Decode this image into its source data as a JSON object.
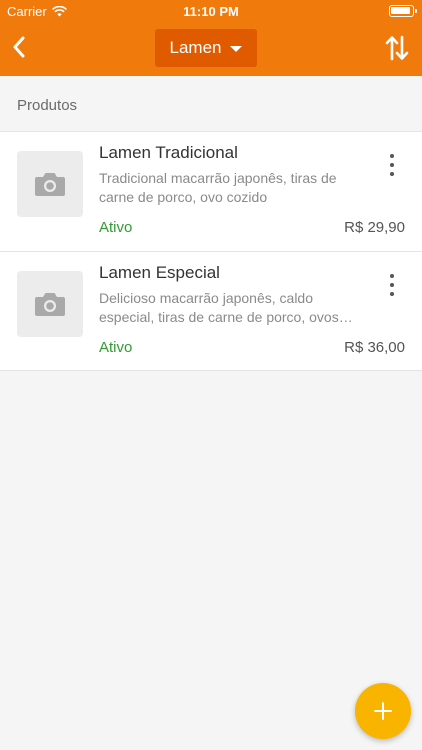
{
  "status_bar": {
    "carrier": "Carrier",
    "time": "11:10 PM"
  },
  "header": {
    "category_label": "Lamen",
    "back_icon": "chevron-left-icon",
    "sort_icon": "sort-arrows-icon"
  },
  "section": {
    "title": "Produtos"
  },
  "products": [
    {
      "name": "Lamen Tradicional",
      "description": "Tradicional macarrão japonês, tiras de carne de porco, ovo cozido",
      "status": "Ativo",
      "price": "R$ 29,90"
    },
    {
      "name": "Lamen Especial",
      "description": "Delicioso macarrão japonês, caldo especial, tiras de carne de porco, ovos cozidos",
      "status": "Ativo",
      "price": "R$ 36,00"
    }
  ],
  "colors": {
    "header": "#f07a0c",
    "category_button": "#e05a00",
    "status_active": "#2e9c2e",
    "fab": "#f9b400",
    "background": "#f5f5f5"
  }
}
